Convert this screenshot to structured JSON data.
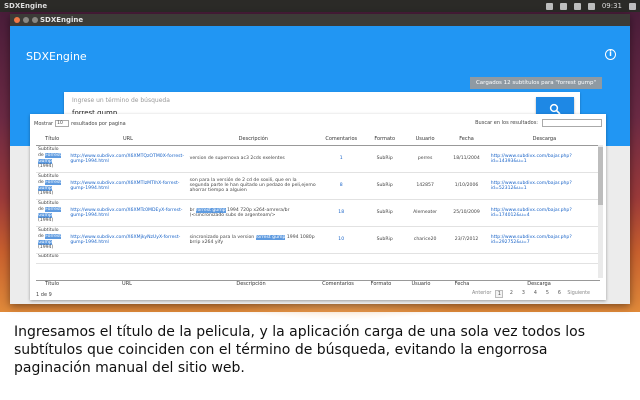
{
  "system_bar": {
    "app_name": "SDXEngine",
    "clock": "09:31"
  },
  "window": {
    "title": "SDXEngine"
  },
  "appbar": {
    "title": "SDXEngine",
    "chip": "Cargados 12 subtítulos para \"forrest gump\"",
    "colors": {
      "primary": "#2196f3",
      "button": "#1e88e5"
    }
  },
  "search": {
    "placeholder": "Ingrese un término de búsqueda",
    "value": "forrest gump"
  },
  "table": {
    "length_prefix": "Mostrar",
    "length_value": "10",
    "length_suffix": "resultados por pagina",
    "filter_label": "Buscar en los resultados:",
    "columns": [
      "Título",
      "URL",
      "Descripción",
      "Comentarios",
      "Formato",
      "Usuario",
      "Fecha",
      "Descarga"
    ],
    "rows": [
      {
        "title_lines": [
          "Subtitulo",
          "de Forrest",
          "Gump",
          "(1994)"
        ],
        "url": "http://www.subdivx.com/X6XMTQzOTM0X-forrest-gump-1994.html",
        "description": "version de supernova ac3 2cds exelentes",
        "comments": "1",
        "format": "SubRip",
        "user": "perres",
        "date": "18/11/2004",
        "download": "http://www.subdivx.com/bajar.php?id=14393&u=1"
      },
      {
        "title_lines": [
          "Subtitulo",
          "de Forrest",
          "Gump",
          "(1994)"
        ],
        "url": "http://www.subdivx.com/X6XMTIzMTIhX-forrest-gump-1994.html",
        "description": "son para la versión de 2 cd de soxili, que en la segunda parte le han quitado un pedazo de peli,ejemo ahorrar tiempo a alguien",
        "comments": "8",
        "format": "SubRip",
        "user": "142857",
        "date": "1/10/2006",
        "download": "http://www.subdivx.com/bajar.php?id=52312&u=1"
      },
      {
        "title_lines": [
          "Subtitulo",
          "de Forrest",
          "Gump",
          "(1994)"
        ],
        "url": "http://www.subdivx.com/X6XMTc0MDEyX-forrest-gump-1994.html",
        "description": "br forrest gump 1994 720p x264-amrera/br (<sincronizado subs de argenteam/>",
        "comments": "18",
        "format": "SubRip",
        "user": "Alemeater",
        "date": "25/10/2009",
        "download": "http://www.subdivx.com/bajar.php?id=174012&u=4"
      },
      {
        "title_lines": [
          "Subtitulo",
          "de Forrest",
          "Gump",
          "(1994)"
        ],
        "url": "http://www.subdivx.com/X6XMjkyNzUyX-forrest-gump-1994.html",
        "description": "sincronizado para la version forrest gump 1994 1080p brrip x264 yify",
        "comments": "10",
        "format": "SubRip",
        "user": "charice20",
        "date": "23/7/2012",
        "download": "http://www.subdivx.com/bajar.php?id=292752&u=7"
      }
    ],
    "partial_row_title": "Subtitulo",
    "info": "1 de 9",
    "pager": {
      "prev": "Anterior",
      "pages": [
        "1",
        "2",
        "3",
        "4",
        "5",
        "6"
      ],
      "current": "1",
      "next": "Siguiente"
    }
  },
  "caption": "Ingresamos el título de la pelicula, y la aplicación carga de una sola vez todos los subtítulos que coinciden con el término de búsqueda, evitando la engorrosa paginación manual del sitio web."
}
